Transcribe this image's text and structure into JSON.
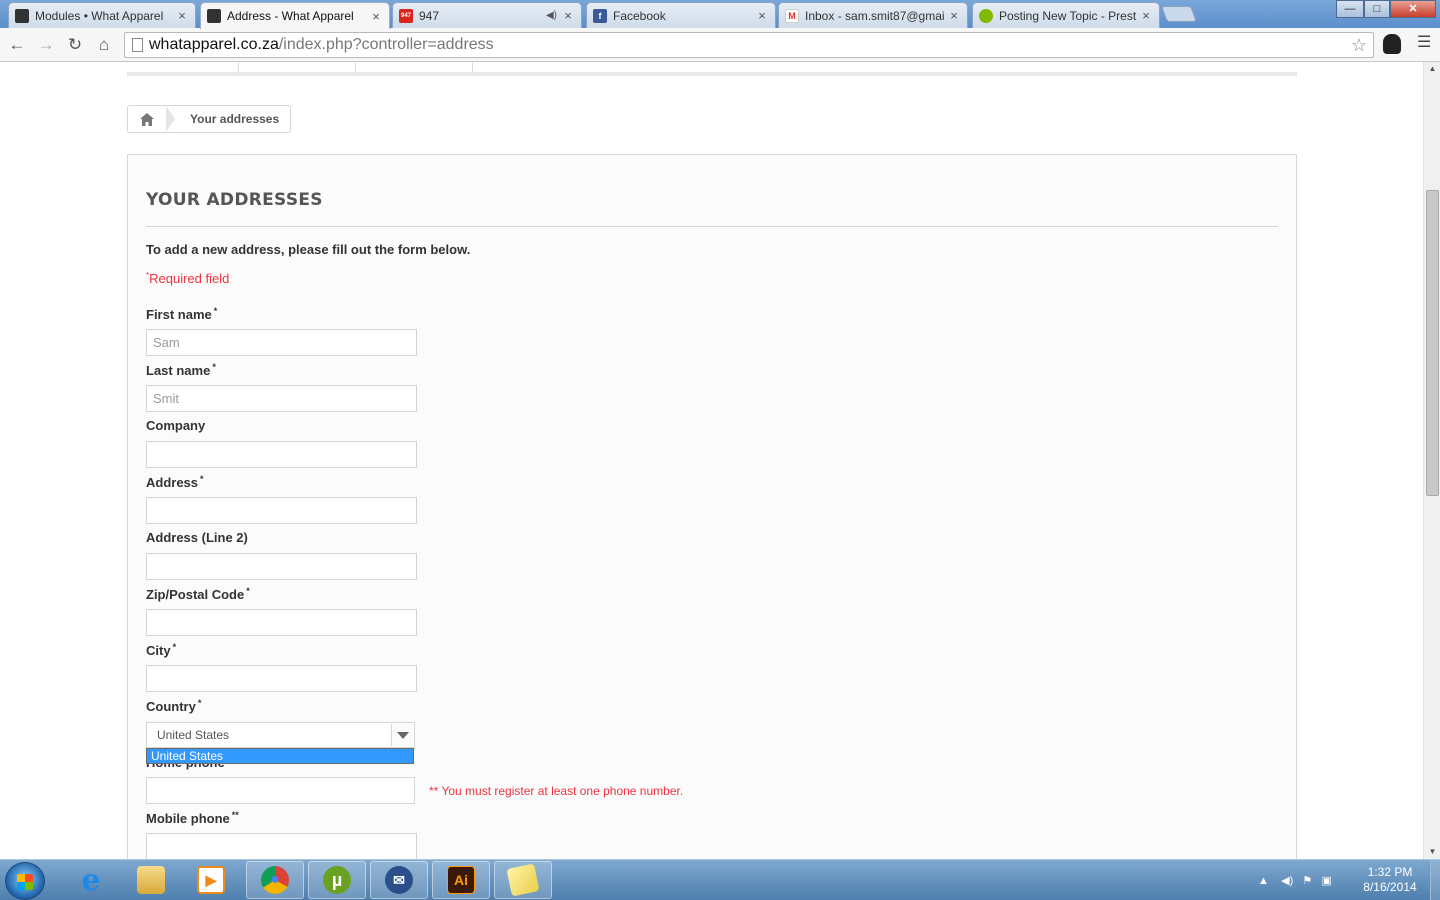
{
  "browser": {
    "tabs": [
      {
        "label": "Modules • What Apparel",
        "favicon_color": "#333333"
      },
      {
        "label": "Address - What Apparel",
        "favicon_color": "#333333",
        "active": true
      },
      {
        "label": "947",
        "favicon_color": "#d9251c",
        "favicon_text": "947"
      },
      {
        "label": "Facebook",
        "favicon_color": "#3b5998",
        "favicon_text": "f"
      },
      {
        "label": "Inbox - sam.smit87@gmai",
        "favicon_color": "#ffffff",
        "favicon_text": "M"
      },
      {
        "label": "Posting New Topic - Prest",
        "favicon_color": "#7fba00"
      }
    ],
    "url_host": "whatapparel.co.za",
    "url_path": "/index.php?controller=address",
    "window_controls": {
      "minimize": "—",
      "maximize": "□",
      "close": "✕"
    }
  },
  "page": {
    "breadcrumb": {
      "current": "Your addresses"
    },
    "heading": "YOUR ADDRESSES",
    "intro": "To add a new address, please fill out the form below.",
    "required_note": {
      "mark": "*",
      "text": "Required field"
    },
    "fields": {
      "first_name": {
        "label": "First name",
        "required": "*",
        "value": "Sam"
      },
      "last_name": {
        "label": "Last name",
        "required": "*",
        "value": "Smit"
      },
      "company": {
        "label": "Company",
        "required": "",
        "value": ""
      },
      "address": {
        "label": "Address",
        "required": "*",
        "value": ""
      },
      "address2": {
        "label": "Address (Line 2)",
        "required": "",
        "value": ""
      },
      "postcode": {
        "label": "Zip/Postal Code",
        "required": "*",
        "value": ""
      },
      "city": {
        "label": "City",
        "required": "*",
        "value": ""
      },
      "country": {
        "label": "Country",
        "required": "*",
        "selected": "United States",
        "options": [
          "United States"
        ]
      },
      "home_phone": {
        "label": "Home phone",
        "required": "**",
        "value": ""
      },
      "mobile_phone": {
        "label": "Mobile phone",
        "required": "**",
        "value": ""
      }
    },
    "phone_warning": "** You must register at least one phone number."
  },
  "taskbar": {
    "apps": [
      {
        "name": "internet-explorer",
        "color": "#1e88e5",
        "text": "e"
      },
      {
        "name": "file-explorer",
        "color": "#e8c25a",
        "text": ""
      },
      {
        "name": "media-player",
        "color": "#ef8a17",
        "text": "▶"
      },
      {
        "name": "chrome",
        "color": "#db4437",
        "text": "●"
      },
      {
        "name": "utorrent",
        "color": "#6aa121",
        "text": "µ"
      },
      {
        "name": "thunderbird",
        "color": "#2a4f8a",
        "text": "✉"
      },
      {
        "name": "illustrator",
        "color": "#8a3b0c",
        "text": "Ai"
      },
      {
        "name": "sticky-notes",
        "color": "#f5e27a",
        "text": ""
      }
    ],
    "clock": {
      "time": "1:32 PM",
      "date": "8/16/2014"
    }
  }
}
